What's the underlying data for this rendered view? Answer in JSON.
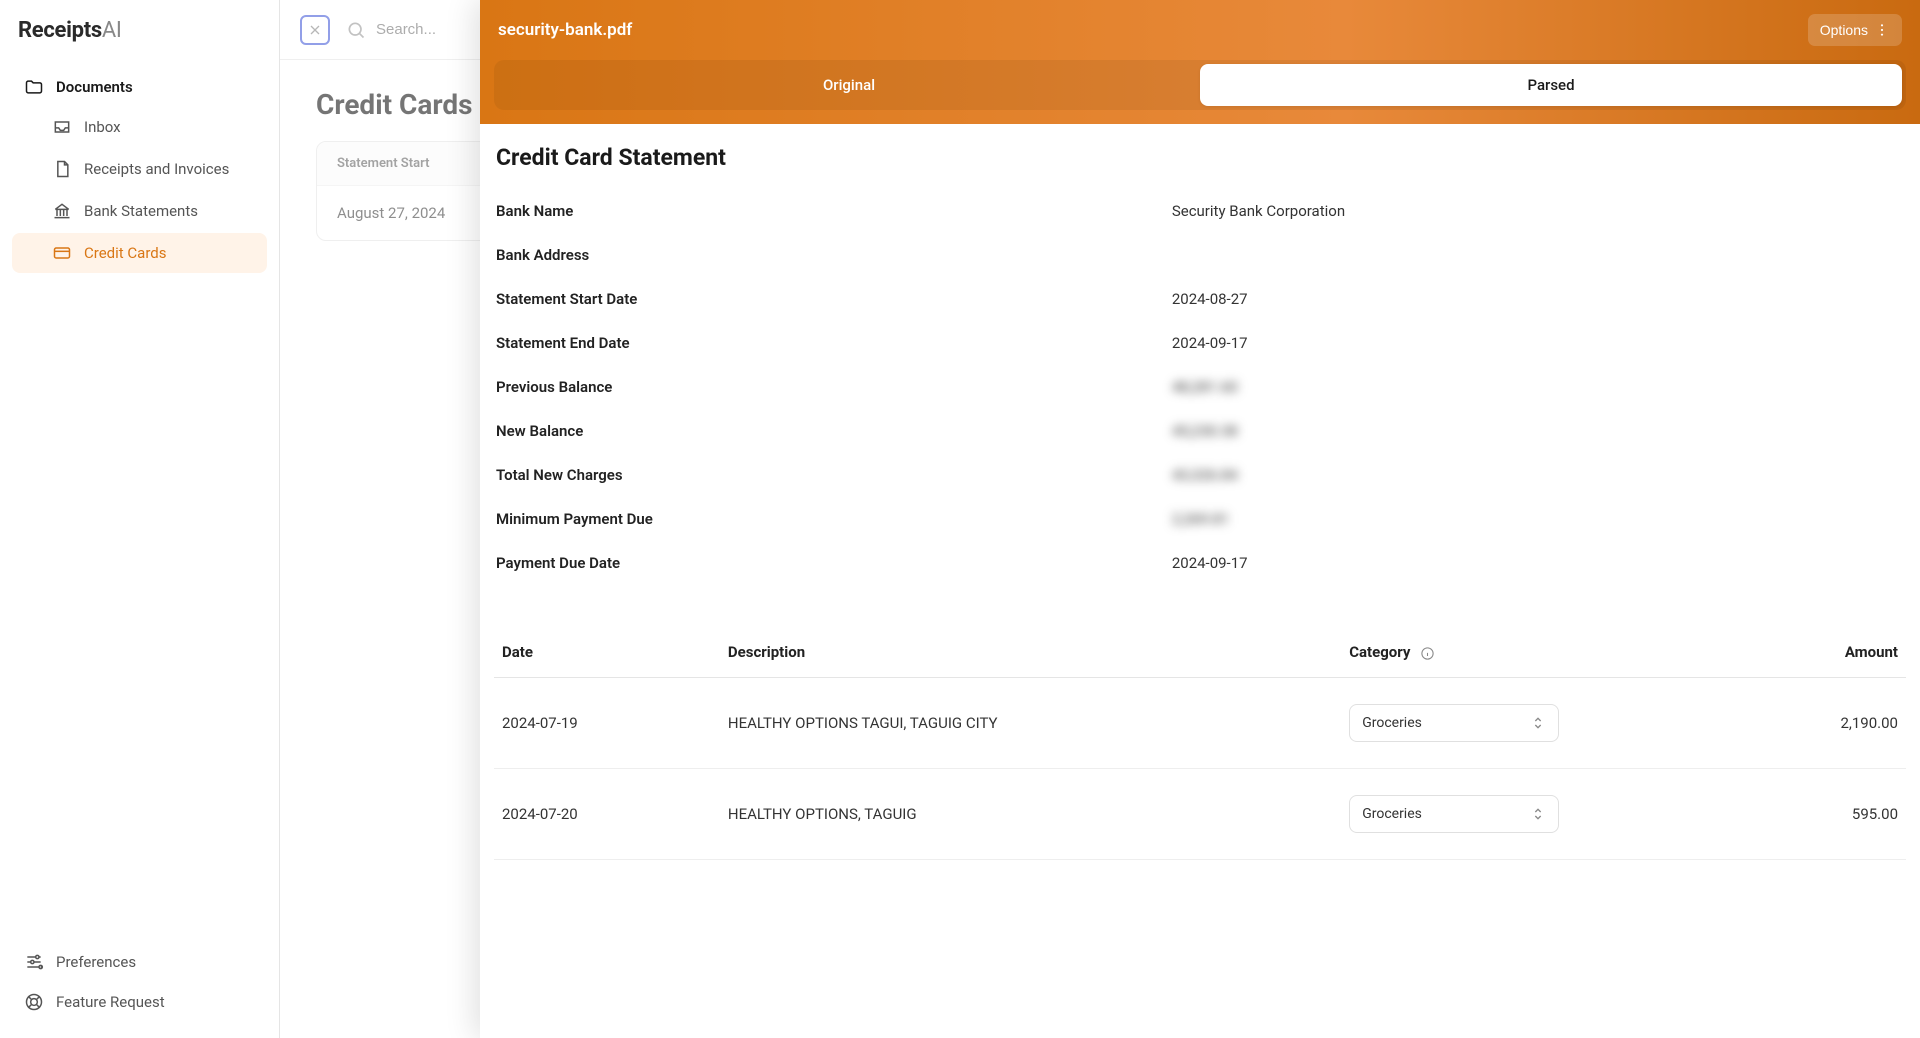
{
  "logo": {
    "brand": "Receipts",
    "suffix": "AI"
  },
  "nav": {
    "header": "Documents",
    "items": [
      {
        "label": "Inbox"
      },
      {
        "label": "Receipts and Invoices"
      },
      {
        "label": "Bank Statements"
      },
      {
        "label": "Credit Cards"
      }
    ]
  },
  "footer": {
    "preferences": "Preferences",
    "feature_request": "Feature Request"
  },
  "search": {
    "placeholder": "Search..."
  },
  "page": {
    "title": "Credit Cards",
    "list_header": "Statement Start",
    "list_row_date": "August 27, 2024"
  },
  "panel": {
    "filename": "security-bank.pdf",
    "options_label": "Options",
    "tabs": {
      "original": "Original",
      "parsed": "Parsed"
    },
    "section_title": "Credit Card Statement",
    "fields": {
      "bank_name": {
        "label": "Bank Name",
        "value": "Security Bank Corporation"
      },
      "bank_address": {
        "label": "Bank Address",
        "value": ""
      },
      "statement_start": {
        "label": "Statement Start Date",
        "value": "2024-08-27"
      },
      "statement_end": {
        "label": "Statement End Date",
        "value": "2024-09-17"
      },
      "previous_balance": {
        "label": "Previous Balance",
        "value": "48,281.60",
        "blurred": true
      },
      "new_balance": {
        "label": "New Balance",
        "value": "45,230.38",
        "blurred": true
      },
      "total_new_charges": {
        "label": "Total New Charges",
        "value": "43,326.84",
        "blurred": true
      },
      "minimum_payment_due": {
        "label": "Minimum Payment Due",
        "value": "2,269.81",
        "blurred": true
      },
      "payment_due_date": {
        "label": "Payment Due Date",
        "value": "2024-09-17"
      }
    },
    "tx_headers": {
      "date": "Date",
      "description": "Description",
      "category": "Category",
      "amount": "Amount"
    },
    "transactions": [
      {
        "date": "2024-07-19",
        "description": "HEALTHY OPTIONS TAGUI, TAGUIG CITY",
        "category": "Groceries",
        "amount": "2,190.00"
      },
      {
        "date": "2024-07-20",
        "description": "HEALTHY OPTIONS, TAGUIG",
        "category": "Groceries",
        "amount": "595.00"
      }
    ]
  }
}
